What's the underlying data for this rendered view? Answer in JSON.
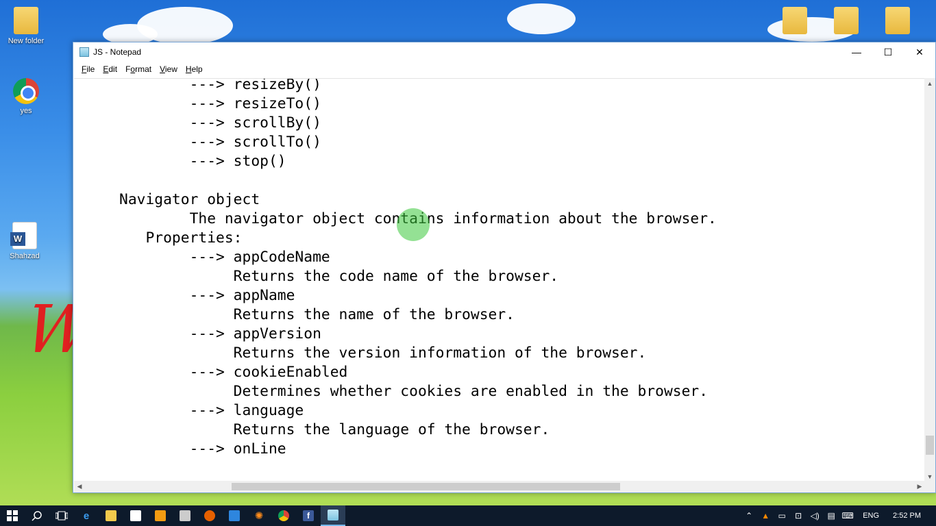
{
  "desktop": {
    "icons": [
      {
        "label": "New folder"
      },
      {
        "label": "yes"
      },
      {
        "label": "Shahzad"
      }
    ]
  },
  "window": {
    "title": "JS - Notepad",
    "menu": [
      {
        "label": "File",
        "accel": "F",
        "rest": "ile"
      },
      {
        "label": "Edit",
        "accel": "E",
        "rest": "dit"
      },
      {
        "label": "Format",
        "accel": "o",
        "pre": "F",
        "rest": "rmat"
      },
      {
        "label": "View",
        "accel": "V",
        "rest": "iew"
      },
      {
        "label": "Help",
        "accel": "H",
        "rest": "elp"
      }
    ],
    "controls": {
      "minimize": "—",
      "maximize": "☐",
      "close": "✕"
    }
  },
  "editor": {
    "lines": [
      "        ---> resizeBy()",
      "        ---> resizeTo()",
      "        ---> scrollBy()",
      "        ---> scrollTo()",
      "        ---> stop()",
      "",
      "Navigator object",
      "        The navigator object contains information about the browser.",
      "   Properties:",
      "        ---> appCodeName",
      "             Returns the code name of the browser.",
      "        ---> appName",
      "             Returns the name of the browser.",
      "        ---> appVersion",
      "             Returns the version information of the browser.",
      "        ---> cookieEnabled",
      "             Determines whether cookies are enabled in the browser.",
      "        ---> language",
      "             Returns the language of the browser.",
      "        ---> onLine"
    ]
  },
  "taskbar": {
    "apps": [
      {
        "icon": "windows-start-icon"
      },
      {
        "icon": "search-icon"
      },
      {
        "icon": "task-view-icon"
      },
      {
        "icon": "edge-icon"
      },
      {
        "icon": "file-explorer-icon"
      },
      {
        "icon": "store-icon"
      },
      {
        "icon": "media-player-icon"
      },
      {
        "icon": "film-icon"
      },
      {
        "icon": "firefox-icon"
      },
      {
        "icon": "app-icon"
      },
      {
        "icon": "sun-app-icon"
      },
      {
        "icon": "chrome-icon"
      },
      {
        "icon": "facebook-icon"
      },
      {
        "icon": "notepad-icon"
      }
    ],
    "tray": {
      "language": "ENG",
      "time": "2:52 PM"
    }
  }
}
